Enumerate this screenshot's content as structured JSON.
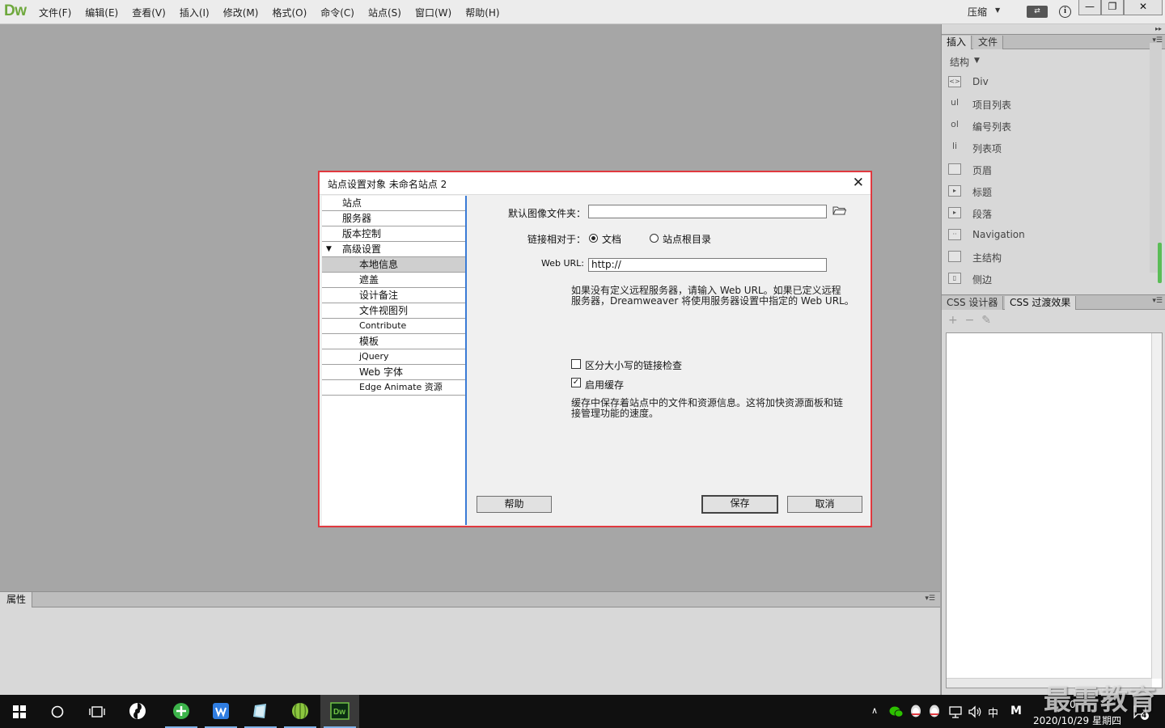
{
  "app": {
    "logo": "Dw"
  },
  "menubar": {
    "items": [
      "文件(F)",
      "编辑(E)",
      "查看(V)",
      "插入(I)",
      "修改(M)",
      "格式(O)",
      "命令(C)",
      "站点(S)",
      "窗口(W)",
      "帮助(H)"
    ],
    "compress_label": "压缩",
    "min_label": "—",
    "max_label": "❐",
    "close_label": "✕"
  },
  "right_panel": {
    "top_tabs": [
      "插入",
      "文件"
    ],
    "insert_category": "结构",
    "insert_items": [
      {
        "icon": "div-icon",
        "label": "Div"
      },
      {
        "icon": "ul-icon",
        "label": "项目列表"
      },
      {
        "icon": "ol-icon",
        "label": "编号列表"
      },
      {
        "icon": "li-icon",
        "label": "列表项"
      },
      {
        "icon": "header-icon",
        "label": "页眉"
      },
      {
        "icon": "heading-icon",
        "label": "标题"
      },
      {
        "icon": "paragraph-icon",
        "label": "段落"
      },
      {
        "icon": "navigation-icon",
        "label": "Navigation"
      },
      {
        "icon": "main-icon",
        "label": "主结构"
      },
      {
        "icon": "aside-icon",
        "label": "侧边"
      }
    ],
    "css_tabs": [
      "CSS 设计器",
      "CSS 过渡效果"
    ],
    "css_tools": [
      "+",
      "−",
      "✎"
    ]
  },
  "properties": {
    "tab": "属性"
  },
  "dialog": {
    "title": "站点设置对象 未命名站点 2",
    "close": "✕",
    "nav": [
      {
        "label": "站点",
        "level": 0
      },
      {
        "label": "服务器",
        "level": 0
      },
      {
        "label": "版本控制",
        "level": 0
      },
      {
        "label": "高级设置",
        "level": 0,
        "expanded": true
      },
      {
        "label": "本地信息",
        "level": 1,
        "selected": true
      },
      {
        "label": "遮盖",
        "level": 1
      },
      {
        "label": "设计备注",
        "level": 1
      },
      {
        "label": "文件视图列",
        "level": 1
      },
      {
        "label": "Contribute",
        "level": 1
      },
      {
        "label": "模板",
        "level": 1
      },
      {
        "label": "jQuery",
        "level": 1
      },
      {
        "label": "Web 字体",
        "level": 1
      },
      {
        "label": "Edge Animate 资源",
        "level": 1
      }
    ],
    "default_image_folder": {
      "label": "默认图像文件夹：",
      "value": ""
    },
    "link_relative": {
      "label": "链接相对于：",
      "option_doc": "文档",
      "option_root": "站点根目录",
      "selected": "文档"
    },
    "web_url": {
      "label": "Web URL:",
      "value": "http://"
    },
    "web_url_help_1": "如果没有定义远程服务器，请输入 Web URL。如果已定义远程",
    "web_url_help_2": "服务器，Dreamweaver 将使用服务器设置中指定的 Web URL。",
    "case_sensitive": {
      "label": "区分大小写的链接检查",
      "checked": false
    },
    "enable_cache": {
      "label": "启用缓存",
      "checked": true
    },
    "cache_help_1": "缓存中保存着站点中的文件和资源信息。这将加快资源面板和链",
    "cache_help_2": "接管理功能的速度。",
    "buttons": {
      "help": "帮助",
      "save": "保存",
      "cancel": "取消"
    }
  },
  "taskbar": {
    "ime": "中",
    "ime2": "M",
    "clock_time": "0",
    "clock_date": "2020/10/29 星期四",
    "notif_count": "4"
  },
  "watermark": "最需教育"
}
